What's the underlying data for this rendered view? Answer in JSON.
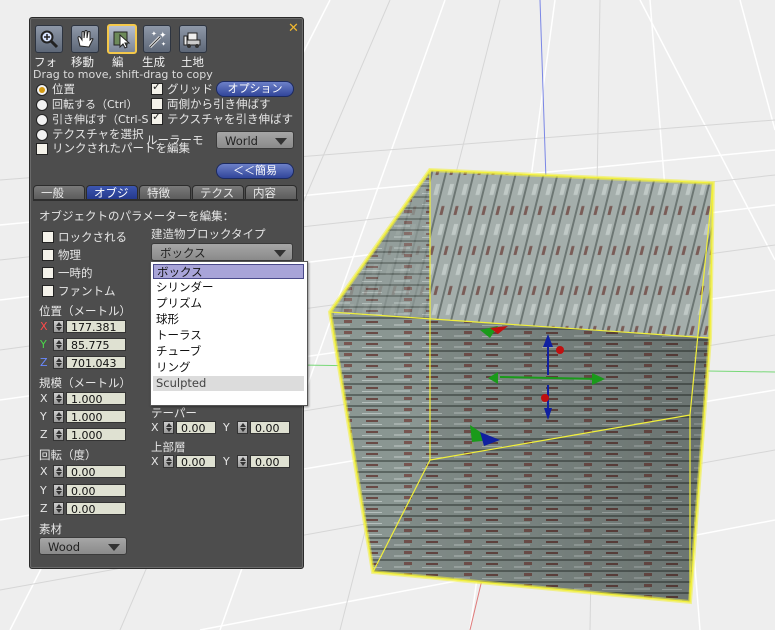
{
  "viewport": {
    "colors": {
      "wood_top": "#9aa2a0",
      "wood_front": "#7d8a86",
      "selection": "#f2f03a"
    }
  },
  "toolbar": {
    "buttons": [
      {
        "label": "フォ",
        "icon": "magnifier-icon"
      },
      {
        "label": "移動",
        "icon": "grab-hand-icon"
      },
      {
        "label": "編",
        "icon": "edit-cursor-icon"
      },
      {
        "label": "生成",
        "icon": "magic-wand-icon"
      },
      {
        "label": "土地",
        "icon": "bulldozer-icon"
      }
    ],
    "close": "✕",
    "hint": "Drag to move, shift-drag to copy"
  },
  "modes": {
    "position": "位置",
    "rotate": "回転する（Ctrl）",
    "stretch": "引き伸ばす（Ctrl-S",
    "select_texture": "テクスチャを選択"
  },
  "options": {
    "grid": "グリッド",
    "options_button": "オプション",
    "stretch_both": "両側から引き伸ばす",
    "stretch_texture": "テクスチャを引き伸ばす",
    "ruler_label": "ルーラーモ",
    "ruler_value": "World",
    "edit_linked": "リンクされたパートを編集",
    "simple_button": "＜＜簡易"
  },
  "tabs": [
    "一般",
    "オブジ",
    "特徴",
    "テクス",
    "内容"
  ],
  "object": {
    "heading": "オブジェクトのパラメーターを編集：",
    "locked": "ロックされる",
    "physical": "物理",
    "temporary": "一時的",
    "phantom": "ファントム",
    "position_label": "位置（メートル）",
    "pos": {
      "x": "177.381",
      "y": "85.775",
      "z": "701.043"
    },
    "size_label": "規模（メートル）",
    "size": {
      "x": "1.000",
      "y": "1.000",
      "z": "1.000"
    },
    "rotation_label": "回転（度）",
    "rot": {
      "x": "0.00",
      "y": "0.00",
      "z": "0.00"
    },
    "material_label": "素材",
    "material_value": "Wood",
    "building_block_label": "建造物ブロックタイプ",
    "building_block_value": "ボックス",
    "taper_label": "テーパー",
    "taper": {
      "x": "0.00",
      "y": "0.00"
    },
    "top_shear_label": "上部層",
    "top_shear": {
      "x": "0.00",
      "y": "0.00"
    },
    "axis": {
      "x": "X",
      "y": "Y",
      "z": "Z"
    }
  },
  "shape_menu": [
    "ボックス",
    "シリンダー",
    "プリズム",
    "球形",
    "トーラス",
    "チューブ",
    "リング",
    "Sculpted"
  ]
}
